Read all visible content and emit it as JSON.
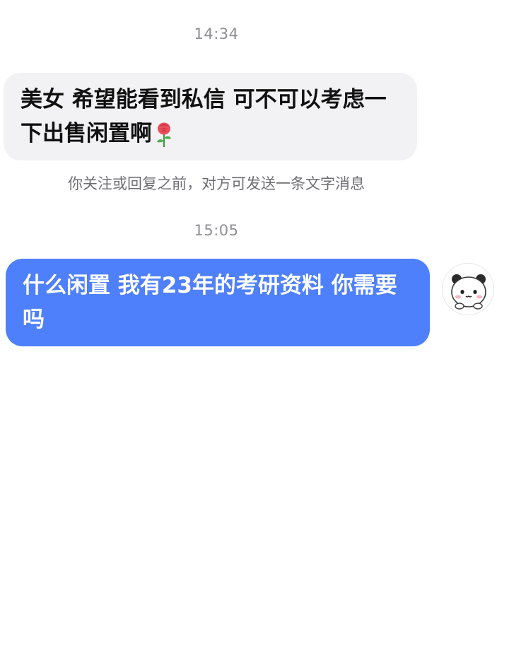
{
  "conversation": {
    "timestamps": [
      "14:34",
      "15:05"
    ],
    "incoming_message": {
      "text": "美女 希望能看到私信 可不可以考虑一下出售闲置啊",
      "emoji_icon": "rose-icon"
    },
    "notice": "你关注或回复之前，对方可发送一条文字消息",
    "outgoing_message": {
      "text": "什么闲置 我有23年的考研资料 你需要吗"
    },
    "avatar_icon": "panda-bear-avatar-icon"
  },
  "colors": {
    "incoming_bg": "#f2f2f4",
    "outgoing_bg": "#4f80fb",
    "timestamp": "#8e8e93"
  }
}
